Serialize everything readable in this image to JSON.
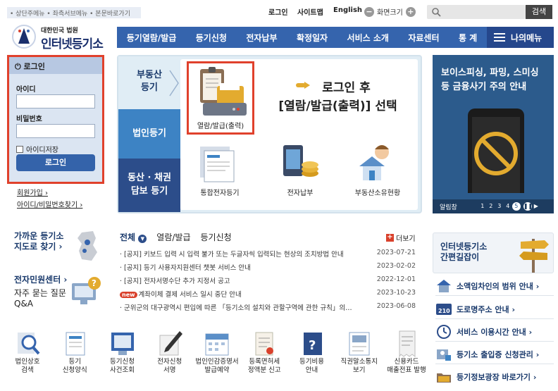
{
  "skip_links": "• 상단주메뉴 • 좌측서브메뉴 • 본문바로가기",
  "util": {
    "login": "로그인",
    "sitemap": "사이트맵",
    "english": "English",
    "zoom_label": "화면크기",
    "zoom_minus": "−",
    "zoom_plus": "+"
  },
  "search": {
    "placeholder": "",
    "button": "검색"
  },
  "logo": {
    "sub": "대한민국 법원",
    "main": "인터넷등기소"
  },
  "gnb": [
    "등기열람/발급",
    "등기신청",
    "전자납부",
    "확정일자",
    "서비스 소개",
    "자료센터",
    "통 계"
  ],
  "my_menu": "나의메뉴",
  "login": {
    "title": "로그인",
    "id_label": "아이디",
    "pw_label": "비밀번호",
    "save_id": "아이디저장",
    "button": "로그인",
    "join": "회원가입 ›",
    "find": "아이디/비밀번호찾기 ›"
  },
  "hero": {
    "tab_realty": [
      "부동산",
      "등기"
    ],
    "tab_corp": "법인등기",
    "tab_movable": [
      "동산 · 채권",
      "담보 등기"
    ],
    "issue_label": "열람/발급(출력)",
    "headline": [
      "로그인 후",
      "[열람/발급(출력)] 선택"
    ],
    "services": [
      "통합전자등기",
      "전자납부",
      "부동산소유현황"
    ]
  },
  "phishing": {
    "title": [
      "보이스피싱, 파밍, 스미싱",
      "등 금융사기 주의 안내"
    ],
    "bar_label": "알림창",
    "pages": [
      "1",
      "2",
      "3",
      "4",
      "5"
    ],
    "active_page": "5"
  },
  "left_info": {
    "map": [
      "가까운 등기소",
      "지도로 찾기 ›"
    ],
    "center": "전자민원센터 ›",
    "faq": [
      "자주 묻는 질문",
      "Q&A"
    ]
  },
  "notice": {
    "tabs": [
      "전체",
      "열람/발급",
      "등기신청"
    ],
    "more": "더보기",
    "rows": [
      {
        "text": "[공지] 키보드 입력 시 입력 불가 또는 두글자씩 입력되는 현상의 조치방법 안내",
        "date": "2023-07-21",
        "new": false
      },
      {
        "text": "[공지] 등기 사용자지원센터 챗봇 서비스 안내",
        "date": "2023-02-02",
        "new": false
      },
      {
        "text": "[공지] 전자서명수단 추가 지정서 공고",
        "date": "2022-12-01",
        "new": false
      },
      {
        "text": "계좌이체 결제 서비스 일시 중단 안내",
        "date": "2023-10-23",
        "new": true,
        "badge": "new"
      },
      {
        "text": "군위군의 대구광역시 편입에 따른 「등기소의 설치와 관할구역에 관한 규칙」의…",
        "date": "2023-06-08",
        "new": false
      }
    ]
  },
  "shortcut": {
    "title": [
      "인터넷등기소",
      "간편길잡이"
    ]
  },
  "quick_links": [
    "소액임차인의 범위 안내 ›",
    "도로명주소 안내 ›",
    "서비스 이용시간 안내 ›",
    "등기소 출입증 신청관리 ›",
    "등기정보광장 바로가기 ›"
  ],
  "quick_icon_texts": {
    "road_code": "210"
  },
  "bottom_icons": [
    [
      "법인상호",
      "검색"
    ],
    [
      "등기",
      "신청양식"
    ],
    [
      "등기신청",
      "사건조회"
    ],
    [
      "전자신청",
      "서명"
    ],
    [
      "법인인감증명서",
      "발급예약"
    ],
    [
      "등록면허세",
      "정액분 신고"
    ],
    [
      "등기비용",
      "안내"
    ],
    [
      "직권말소통지",
      "보기"
    ],
    [
      "신용카드",
      "매출전표 발행"
    ]
  ],
  "colors": {
    "accent": "#3564ad",
    "dark": "#25478c",
    "highlight": "#e0412c",
    "phish": "#2c5b8c"
  }
}
